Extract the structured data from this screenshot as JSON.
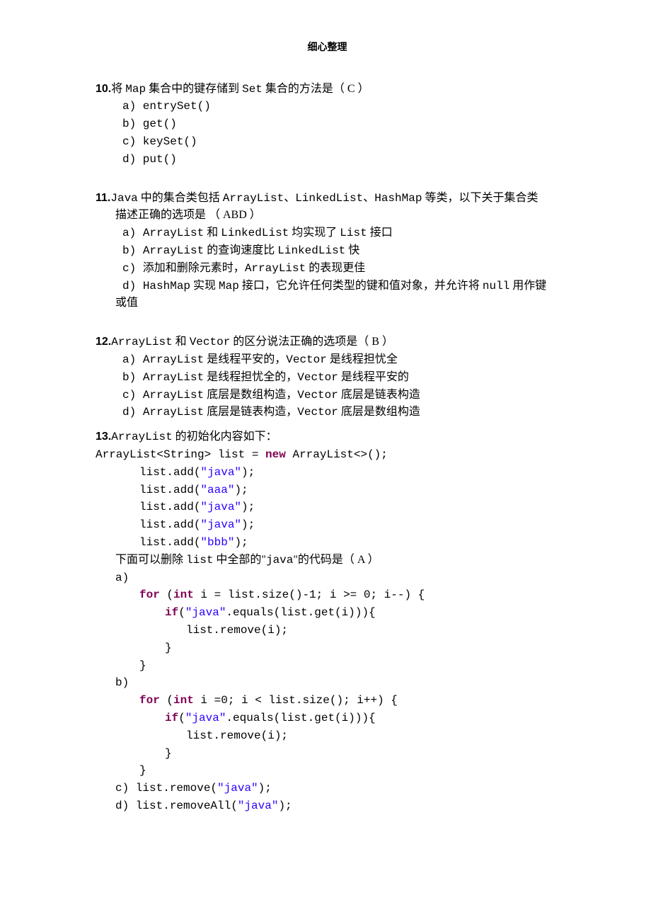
{
  "header": "细心整理",
  "q10": {
    "num": "10.",
    "stem_p1": "将 ",
    "stem_m1": "Map",
    "stem_p2": " 集合中的键存储到 ",
    "stem_m2": "Set",
    "stem_p3": " 集合的方法是（  C  ）",
    "a": "a)  entrySet()",
    "b": "b)  get()",
    "c": "c)  keySet()",
    "d": "d)  put()"
  },
  "q11": {
    "num": "11.",
    "stem_p1": "Java",
    "stem_p2": " 中的集合类包括 ",
    "stem_m1": "ArrayList、LinkedList、HashMap",
    "stem_p3": " 等类，以下关于集合类",
    "stem_cont": "描述正确的选项是 （ ABD ）",
    "a_p1": "a)   ",
    "a_m1": "ArrayList",
    "a_p2": " 和 ",
    "a_m2": "LinkedList",
    "a_p3": " 均实现了 ",
    "a_m3": "List",
    "a_p4": " 接口",
    "b_p1": "b)   ",
    "b_m1": "ArrayList",
    "b_p2": " 的查询速度比 ",
    "b_m2": "LinkedList",
    "b_p3": " 快",
    "c_p1": "c)   添加和删除元素时，",
    "c_m1": "ArrayList",
    "c_p2": " 的表现更佳",
    "d_p1": "d)   ",
    "d_m1": "HashMap",
    "d_p2": " 实现 ",
    "d_m2": "Map",
    "d_p3": " 接口，它允许任何类型的键和值对象，并允许将 ",
    "d_m3": "null",
    "d_p4": " 用作键",
    "d_cont": "或值"
  },
  "q12": {
    "num": "12.",
    "stem_m1": "ArrayList",
    "stem_p1": " 和 ",
    "stem_m2": "Vector",
    "stem_p2": " 的区分说法正确的选项是（ B   ）",
    "a_p1": "a) ",
    "a_m1": "ArrayList",
    "a_p2": " 是线程平安的，",
    "a_m2": "Vector",
    "a_p3": " 是线程担忧全",
    "b_p1": "b) ",
    "b_m1": "ArrayList",
    "b_p2": " 是线程担忧全的，",
    "b_m2": "Vector",
    "b_p3": " 是线程平安的",
    "c_p1": "c) ",
    "c_m1": "ArrayList",
    "c_p2": " 底层是数组构造，",
    "c_m2": "Vector",
    "c_p3": " 底层是链表构造",
    "d_p1": "d) ",
    "d_m1": "ArrayList",
    "d_p2": " 底层是链表构造，",
    "d_m2": "Vector",
    "d_p3": " 底层是数组构造"
  },
  "q13": {
    "num": "13.",
    "stem_m1": "ArrayList",
    "stem_p1": " 的初始化内容如下：",
    "init_p0": " ArrayList<String> list = ",
    "init_kw": "new",
    "init_p1": " ArrayList<>();",
    "add1_p": "list.add(",
    "add1_s": "\"java\"",
    "add1_e": ");",
    "add2_p": "list.add(",
    "add2_s": "\"aaa\"",
    "add2_e": ");",
    "add3_p": "list.add(",
    "add3_s": "\"java\"",
    "add3_e": ");",
    "add4_p": "list.add(",
    "add4_s": "\"java\"",
    "add4_e": ");",
    "add5_p": "list.add(",
    "add5_s": "\"bbb\"",
    "add5_e": ");",
    "ask_p1": " 下面可以删除 ",
    "ask_m1": "list",
    "ask_p2": " 中全部的\"",
    "ask_m2": "java",
    "ask_p3": "\"的代码是（  A  ）",
    "a_label": "a)",
    "a_for_kw1": "for",
    "a_for_p1": " (",
    "a_for_kw2": "int",
    "a_for_p2": " i = list.size()-1; i >= 0; i--) {",
    "a_if_kw": "if",
    "a_if_p1": "(",
    "a_if_s": "\"java\"",
    "a_if_p2": ".equals(list.get(i))){",
    "a_remove": "list.remove(i);",
    "a_close1": "}",
    "a_close2": "}",
    "b_label": "b)",
    "b_for_kw1": "for",
    "b_for_p1": " (",
    "b_for_kw2": "int",
    "b_for_p2": " i =0; i < list.size(); i++) {",
    "b_if_kw": "if",
    "b_if_p1": "(",
    "b_if_s": "\"java\"",
    "b_if_p2": ".equals(list.get(i))){",
    "b_remove": "list.remove(i);",
    "b_close1": "}",
    "b_close2": "}",
    "c_p1": "c)  list.remove(",
    "c_s": "\"java\"",
    "c_p2": ");",
    "d_p1": "d)  list.removeAll(",
    "d_s": "\"java\"",
    "d_p2": ");"
  }
}
